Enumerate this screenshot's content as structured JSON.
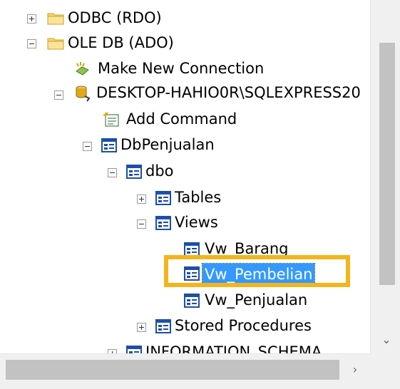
{
  "tree": {
    "nodes": [
      {
        "label": "ODBC (RDO)",
        "icon": "folder-icon",
        "expander": "plus"
      },
      {
        "label": "OLE DB (ADO)",
        "icon": "folder-icon",
        "expander": "minus"
      },
      {
        "label": "Make New Connection",
        "icon": "new-connection-icon"
      },
      {
        "label": "DESKTOP-HAHIO0R\\SQLEXPRESS20",
        "icon": "server-connection-icon",
        "expander": "minus"
      },
      {
        "label": "Add Command",
        "icon": "add-command-icon"
      },
      {
        "label": "DbPenjualan",
        "icon": "database-icon",
        "expander": "minus"
      },
      {
        "label": "dbo",
        "icon": "schema-icon",
        "expander": "minus"
      },
      {
        "label": "Tables",
        "icon": "table-folder-icon",
        "expander": "plus"
      },
      {
        "label": "Views",
        "icon": "view-folder-icon",
        "expander": "minus"
      },
      {
        "label": "Vw_Barang",
        "icon": "view-icon"
      },
      {
        "label": "Vw_Pembelian",
        "icon": "view-icon",
        "selected": true
      },
      {
        "label": "Vw_Penjualan",
        "icon": "view-icon"
      },
      {
        "label": "Stored Procedures",
        "icon": "procedure-folder-icon",
        "expander": "plus"
      },
      {
        "label": "INFORMATION_SCHEMA",
        "icon": "schema-icon",
        "expander": "plus"
      }
    ]
  },
  "colors": {
    "selection": "#3399ff",
    "highlight_box": "#f2b51c",
    "folder": "#f5d76e",
    "object_icon": "#1d4fa8"
  },
  "scrollbars": {
    "vertical_down_arrow": "⌄",
    "horizontal_right_arrow": "›"
  }
}
